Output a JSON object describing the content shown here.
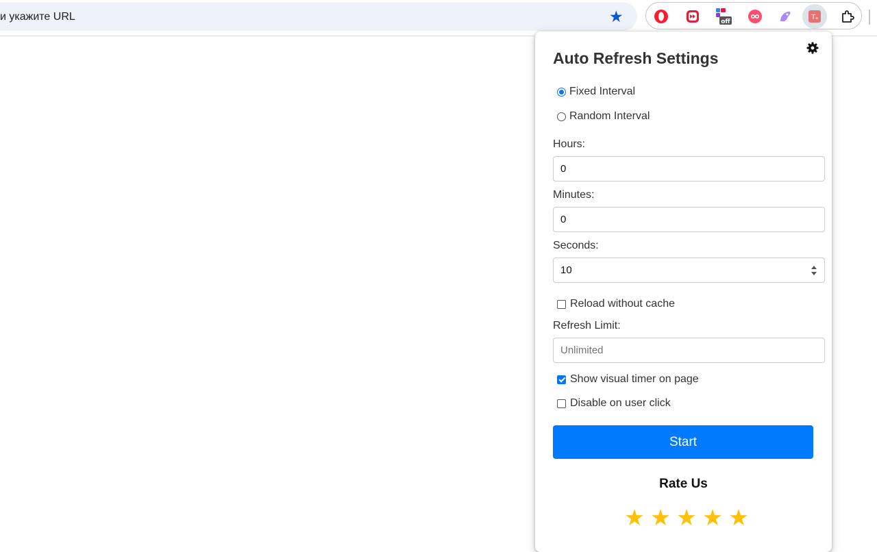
{
  "browser": {
    "address_text": "и укажите URL",
    "bookmark_icon": "star-icon",
    "extensions": [
      {
        "name": "opera-extension-icon",
        "color": "#ff1b2d"
      },
      {
        "name": "fast-forward-extension-icon",
        "color": "#e31e3a"
      },
      {
        "name": "off-extension-icon",
        "color": "#7b3fe4",
        "badge": "off"
      },
      {
        "name": "infinity-extension-icon",
        "color": "#ff4d6d"
      },
      {
        "name": "ai-extension-icon",
        "color": "#a78bfa"
      },
      {
        "name": "translator-extension-icon",
        "color": "#e57373"
      },
      {
        "name": "puzzle-extensions-icon",
        "color": "#1f1f1f"
      }
    ]
  },
  "popup": {
    "title": "Auto Refresh Settings",
    "settings_icon": "gear-icon",
    "interval_mode": {
      "options": [
        {
          "label": "Fixed Interval",
          "selected": true
        },
        {
          "label": "Random Interval",
          "selected": false
        }
      ]
    },
    "hours": {
      "label": "Hours:",
      "value": "0"
    },
    "minutes": {
      "label": "Minutes:",
      "value": "0"
    },
    "seconds": {
      "label": "Seconds:",
      "value": "10"
    },
    "reload_without_cache": {
      "label": "Reload without cache",
      "checked": false
    },
    "refresh_limit": {
      "label": "Refresh Limit:",
      "placeholder": "Unlimited",
      "value": ""
    },
    "show_visual_timer": {
      "label": "Show visual timer on page",
      "checked": true
    },
    "disable_on_click": {
      "label": "Disable on user click",
      "checked": false
    },
    "start_label": "Start",
    "rate_title": "Rate Us",
    "rating": {
      "stars_shown": 5,
      "glyph": "★"
    },
    "colors": {
      "accent": "#007bff",
      "star": "#ffc107",
      "radio_checked": "#0075ff"
    }
  }
}
